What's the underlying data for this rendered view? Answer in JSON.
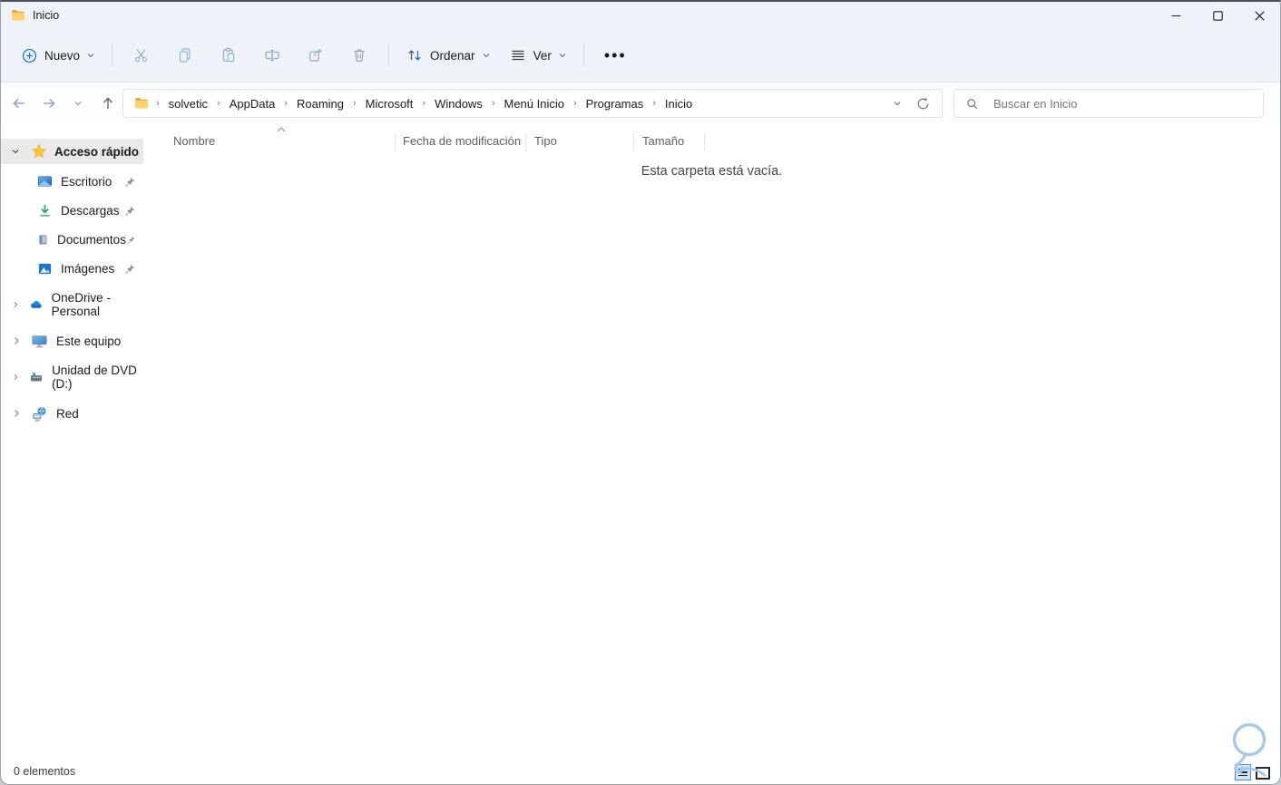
{
  "window": {
    "title": "Inicio"
  },
  "toolbar": {
    "new_label": "Nuevo",
    "sort_label": "Ordenar",
    "view_label": "Ver",
    "more_label": "•••"
  },
  "addressbar": {
    "breadcrumbs": [
      "solvetic",
      "AppData",
      "Roaming",
      "Microsoft",
      "Windows",
      "Menú Inicio",
      "Programas",
      "Inicio"
    ]
  },
  "search": {
    "placeholder": "Buscar en Inicio"
  },
  "sidebar": {
    "quick_access": {
      "label": "Acceso rápido",
      "items": [
        {
          "label": "Escritorio",
          "pinned": true
        },
        {
          "label": "Descargas",
          "pinned": true
        },
        {
          "label": "Documentos",
          "pinned": true
        },
        {
          "label": "Imágenes",
          "pinned": true
        }
      ]
    },
    "groups": [
      {
        "label": "OneDrive - Personal"
      },
      {
        "label": "Este equipo"
      },
      {
        "label": "Unidad de DVD (D:)"
      },
      {
        "label": "Red"
      }
    ]
  },
  "content": {
    "columns": [
      "Nombre",
      "Fecha de modificación",
      "Tipo",
      "Tamaño"
    ],
    "empty_message": "Esta carpeta está vacía."
  },
  "statusbar": {
    "items_count": "0 elementos"
  },
  "icons": {
    "new": "plus-circle-icon",
    "cut": "scissors-icon",
    "copy": "copy-icon",
    "paste": "clipboard-icon",
    "rename": "rename-icon",
    "share": "share-icon",
    "delete": "trash-icon",
    "sort": "sort-arrows-icon",
    "view": "list-lines-icon",
    "search": "magnifier-icon",
    "refresh": "refresh-icon",
    "folder": "folder-icon"
  },
  "colors": {
    "accent": "#1673cf",
    "band": "#eef2f9",
    "selected_row": "#e9e9e9",
    "folder_yellow": "#fcc64c",
    "annotation_blue": "#a5c9ec",
    "download_green": "#17a15e"
  }
}
